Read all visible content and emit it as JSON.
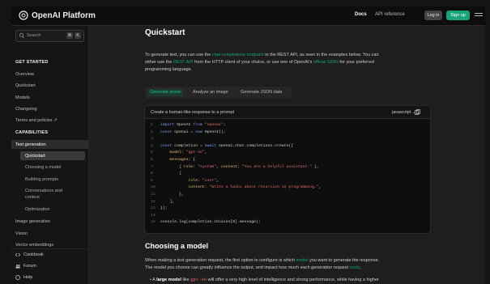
{
  "topbar": {
    "app_title": "OpenAI Platform",
    "nav_docs": "Docs",
    "nav_api_reference": "API reference",
    "login_label": "Log in",
    "signup_label": "Sign up"
  },
  "sidebar": {
    "search_placeholder": "Search",
    "search_kbd_1": "⌘",
    "search_kbd_2": "K",
    "get_started_heading": "GET STARTED",
    "items_top": [
      "Overview",
      "Quickstart",
      "Models",
      "Changelog",
      "Terms and policies ↗"
    ],
    "capabilities_heading": "CAPABILITIES",
    "text_generation": "Text generation",
    "sub_items": [
      "Quickstart",
      "Choosing a model",
      "Building prompts",
      "Conversations and",
      "context",
      "Optimization"
    ],
    "items_after": [
      "Image generation",
      "Vision",
      "Vector embeddings"
    ],
    "bottom": {
      "cookbook": "Cookbook",
      "forum": "Forum",
      "help": "Help"
    }
  },
  "main": {
    "title": "Quickstart",
    "intro": {
      "p1": "To generate text, you can use the ",
      "link1": "chat completions endpoint",
      "p2": " in the REST API, as seen in the examples below. You can",
      "p3": "either use the ",
      "link2": "REST API",
      "p4": " from the HTTP client of your choice, or use one of OpenAI's ",
      "link3": "official SDKs",
      "p5": " for your preferred",
      "p6": "programming language."
    },
    "tabs": [
      "Generate prose",
      "Analyze an image",
      "Generate JSON data"
    ],
    "code": {
      "title": "Create a human-like response to a prompt",
      "language": "javascript ⌄",
      "lines": [
        "import OpenAI from \"openai\";",
        "const openai = new OpenAI();",
        "",
        "const completion = await openai.chat.completions.create({",
        "    model: \"gpt-4o\",",
        "    messages: [",
        "        { role: \"system\", content: \"You are a helpful assistant.\" },",
        "        {",
        "            role: \"user\",",
        "            content: \"Write a haiku about recursion in programming.\",",
        "        },",
        "    ],",
        "});",
        "",
        "console.log(completion.choices[0].message);"
      ]
    },
    "section2_title": "Choosing a model",
    "section2": {
      "p1": "When making a text generation request, the first option to configure is which ",
      "link1": "model",
      "p2": " you want to generate the response.",
      "p3": "The model you choose can greatly influence the output, and impact how much each generation request ",
      "link2": "costs",
      "p4": ".",
      "bullet_a": "A ",
      "bullet_bold": "large model",
      "bullet_b": " like ",
      "bullet_code": "gpt-4o",
      "bullet_c": " will offer a very high level of intelligence and strong performance, while having a higher"
    }
  },
  "colors": {
    "accent": "#19a37a",
    "background": "#1e1e1e",
    "sidebar": "#151515"
  }
}
